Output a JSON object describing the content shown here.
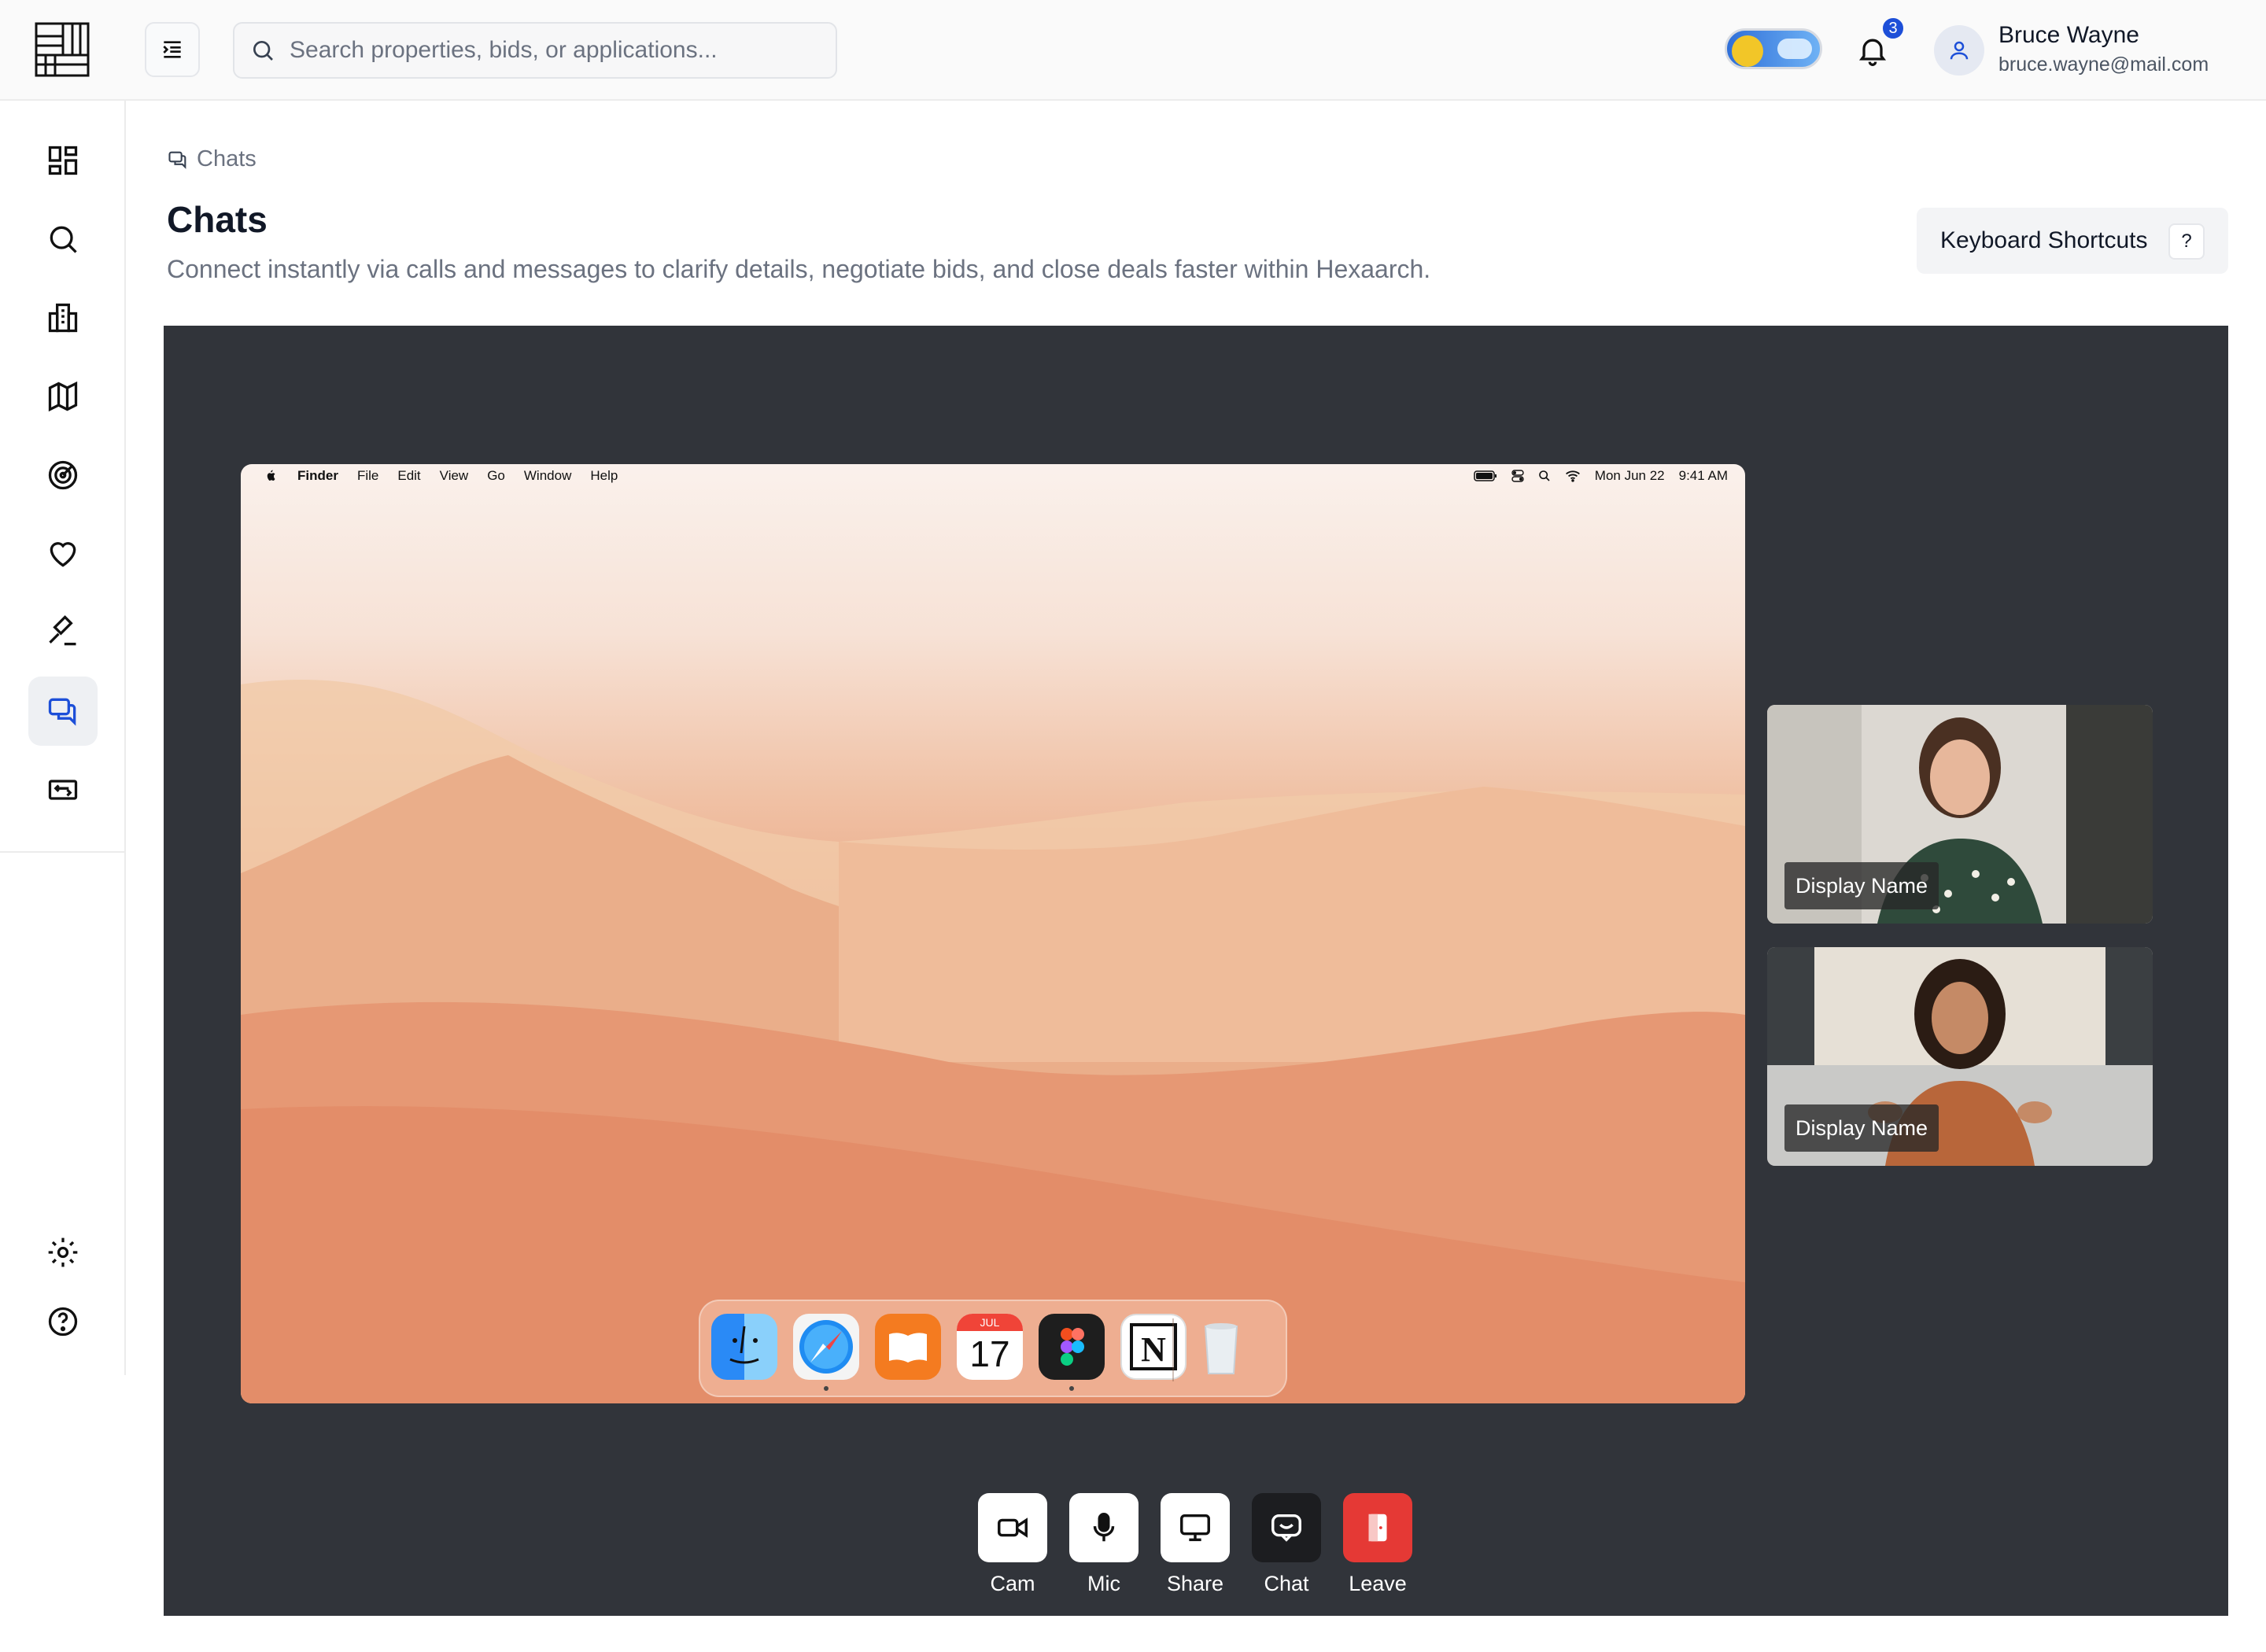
{
  "header": {
    "search_placeholder": "Search properties, bids, or applications...",
    "notification_count": "3",
    "user_name": "Bruce Wayne",
    "user_email": "bruce.wayne@mail.com"
  },
  "sidebar": {
    "items": [
      {
        "icon": "dashboard-icon"
      },
      {
        "icon": "search-icon"
      },
      {
        "icon": "buildings-icon"
      },
      {
        "icon": "map-icon"
      },
      {
        "icon": "radar-icon"
      },
      {
        "icon": "heart-icon"
      },
      {
        "icon": "gavel-icon"
      },
      {
        "icon": "chat-icon",
        "active": true
      },
      {
        "icon": "transfer-icon"
      }
    ],
    "bottom": [
      {
        "icon": "gear-icon"
      },
      {
        "icon": "help-icon"
      }
    ]
  },
  "page": {
    "breadcrumb": "Chats",
    "title": "Chats",
    "description": "Connect instantly via calls and messages to clarify details, negotiate bids, and close deals faster within Hexaarch.",
    "keyboard_shortcuts_label": "Keyboard Shortcuts",
    "keyboard_shortcuts_key": "?"
  },
  "shared_screen": {
    "menubar": [
      "Finder",
      "File",
      "Edit",
      "View",
      "Go",
      "Window",
      "Help"
    ],
    "date": "Mon Jun 22",
    "time": "9:41 AM",
    "calendar_month": "JUL",
    "calendar_day": "17"
  },
  "participants": [
    {
      "display_name": "Display Name"
    },
    {
      "display_name": "Display Name"
    }
  ],
  "controls": {
    "cam": "Cam",
    "mic": "Mic",
    "share": "Share",
    "chat": "Chat",
    "leave": "Leave"
  },
  "colors": {
    "stage_bg": "#31343a",
    "leave_red": "#e53935",
    "badge_blue": "#1d4fd8"
  }
}
